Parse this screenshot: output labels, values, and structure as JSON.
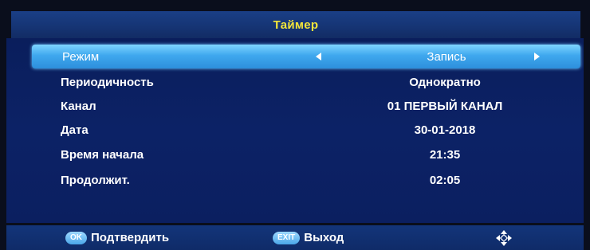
{
  "header": {
    "title": "Таймер"
  },
  "settings": {
    "rows": [
      {
        "label": "Режим",
        "value": "Запись"
      },
      {
        "label": "Периодичность",
        "value": "Однократно"
      },
      {
        "label": "Канал",
        "value": "01 ПЕРВЫЙ КАНАЛ"
      },
      {
        "label": "Дата",
        "value": "30-01-2018"
      },
      {
        "label": "Время начала",
        "value": "21:35"
      },
      {
        "label": "Продолжит.",
        "value": "02:05"
      }
    ]
  },
  "footer": {
    "ok_key": "OK",
    "ok_label": "Подтвердить",
    "exit_key": "EXIT",
    "exit_label": "Выход",
    "nav_icon": "navigation-arrows-icon"
  },
  "colors": {
    "title_text": "#f3e53a",
    "selection": "#3fa8ee",
    "panel": "#0c2266"
  }
}
